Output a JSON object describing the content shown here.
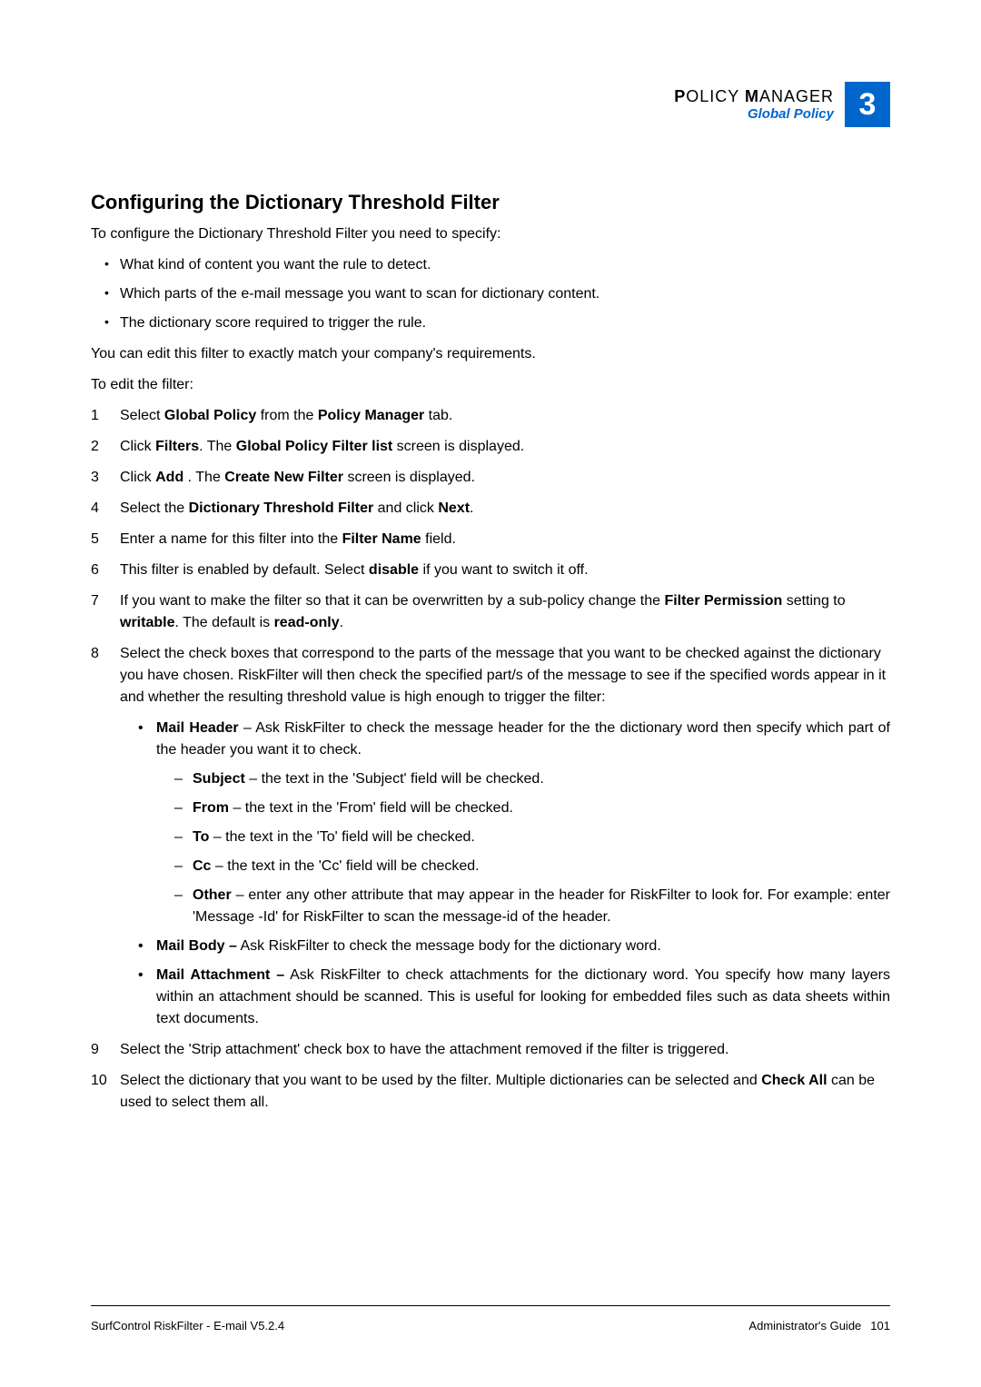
{
  "header": {
    "title_line1_word1": "P",
    "title_line1_rest1": "OLICY",
    "title_line1_word2": "M",
    "title_line1_rest2": "ANAGER",
    "subtitle": "Global Policy",
    "chapter_number": "3"
  },
  "section": {
    "title": "Configuring the Dictionary Threshold Filter",
    "intro": "To configure the Dictionary Threshold Filter you need to specify:",
    "bullets": [
      "What kind of content you want the rule to detect.",
      "Which parts of the e-mail message you want to scan for dictionary content.",
      "The dictionary score required to trigger the rule."
    ],
    "after_bullets": "You can edit this filter to exactly match your company's requirements.",
    "edit_intro": "To edit the filter:"
  },
  "steps": {
    "s1_pre": "Select ",
    "s1_b1": "Global Policy",
    "s1_mid": " from the ",
    "s1_b2": "Policy Manager",
    "s1_post": " tab.",
    "s2_pre": "Click ",
    "s2_b1": "Filters",
    "s2_mid": ". The ",
    "s2_b2": "Global Policy Filter list",
    "s2_post": " screen is displayed.",
    "s3_pre": "Click ",
    "s3_b1": "Add",
    "s3_mid": " . The ",
    "s3_b2": "Create New Filter",
    "s3_post": " screen is displayed.",
    "s4_pre": "Select the ",
    "s4_b1": "Dictionary Threshold Filter",
    "s4_mid": " and click ",
    "s4_b2": "Next",
    "s4_post": ".",
    "s5_pre": "Enter a name for this filter into the ",
    "s5_b1": "Filter Name",
    "s5_post": " field.",
    "s6_pre": "This filter is enabled by default. Select ",
    "s6_b1": "disable",
    "s6_post": " if you want to switch it off.",
    "s7_pre": "If you want to make the filter so that it can be overwritten by a sub-policy change the ",
    "s7_b1": "Filter Permission",
    "s7_mid": " setting to ",
    "s7_b2": "writable",
    "s7_mid2": ". The default is ",
    "s7_b3": "read-only",
    "s7_post": ".",
    "s8_text": "Select the check boxes that correspond to the parts of the message that you want to be checked against the dictionary you have chosen. RiskFilter will then check the specified part/s of the message to see if the specified words appear in it and whether the resulting threshold value is high enough to trigger the filter:",
    "s8_sub1_b": "Mail Header",
    "s8_sub1_text": " – Ask RiskFilter to check the message header for the the dictionary word then specify which part of the header you want it to check.",
    "s8_d1_b": "Subject",
    "s8_d1_text": " – the text in the 'Subject' field will be checked.",
    "s8_d2_b": "From",
    "s8_d2_text": " – the text in the 'From' field will be checked.",
    "s8_d3_b": "To",
    "s8_d3_text": " –  the text in the 'To' field will be checked.",
    "s8_d4_b": "Cc",
    "s8_d4_text": " – the text in the 'Cc' field will be checked.",
    "s8_d5_b": "Other",
    "s8_d5_text": " – enter any other attribute that may appear in the header for RiskFilter to look for. For example: enter 'Message -Id' for RiskFilter to scan the message-id of the header.",
    "s8_sub2_b": "Mail Body –",
    "s8_sub2_text": " Ask RiskFilter to check the message body for the dictionary word.",
    "s8_sub3_b": "Mail Attachment –",
    "s8_sub3_text": " Ask RiskFilter to check attachments for the dictionary word. You specify how many layers within an attachment should be scanned. This is useful for looking for embedded files such as data sheets within text documents.",
    "s9_text": "Select the 'Strip attachment' check box to have the attachment removed if the filter is triggered.",
    "s10_pre": "Select the dictionary that you want to be used by the filter. Multiple dictionaries can be selected and ",
    "s10_b1": "Check All",
    "s10_post": " can be used to select them all."
  },
  "footer": {
    "left": "SurfControl RiskFilter - E-mail V5.2.4",
    "right_label": "Administrator's Guide",
    "page_number": "101"
  }
}
